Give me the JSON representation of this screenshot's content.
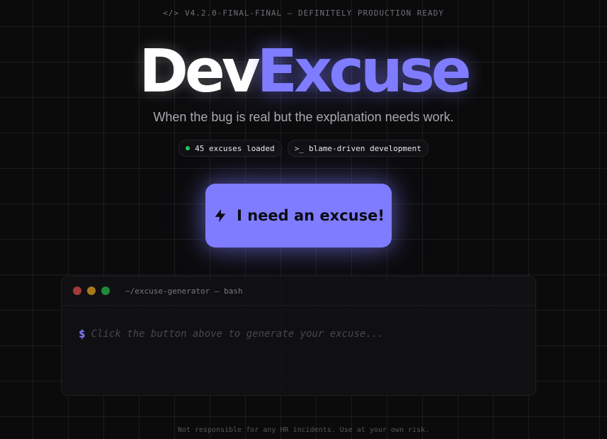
{
  "header": {
    "version_icon": "code-icon",
    "version_glyph": "</>",
    "version_text": "V4.2.0-FINAL-FINAL — DEFINITELY PRODUCTION READY"
  },
  "title": {
    "part1": "Dev",
    "part2": "Excuse"
  },
  "tagline": "When the bug is real but the explanation needs work.",
  "badges": [
    {
      "icon": "status-dot",
      "text": "45 excuses loaded"
    },
    {
      "icon": "terminal-prompt-icon",
      "glyph": ">_",
      "text": "blame-driven development"
    }
  ],
  "cta": {
    "icon": "lightning-bolt-icon",
    "label": "I need an excuse!"
  },
  "terminal": {
    "title": "~/excuse-generator — bash",
    "prompt": "$",
    "placeholder": "Click the button above to generate your excuse..."
  },
  "footer": "Not responsible for any HR incidents. Use at your own risk.",
  "colors": {
    "accent": "#7f7cff",
    "background": "#0b0b0c",
    "status_green": "#22c55e"
  }
}
